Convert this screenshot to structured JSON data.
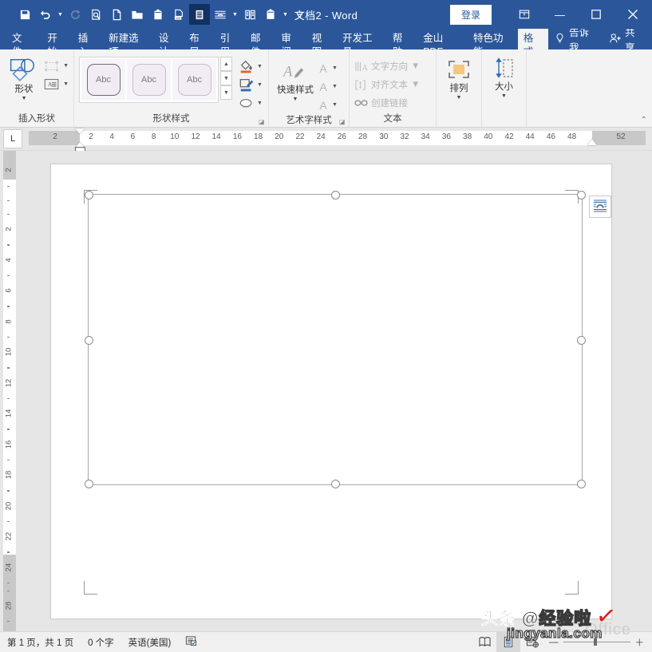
{
  "titlebar": {
    "document_title": "文档2  -  Word",
    "sign_in": "登录",
    "quick_access": [
      {
        "name": "save",
        "glyph": "save"
      },
      {
        "name": "undo",
        "glyph": "undo",
        "has_caret": true
      },
      {
        "name": "redo",
        "glyph": "redo"
      },
      {
        "name": "print-preview",
        "glyph": "preview"
      },
      {
        "name": "new-document",
        "glyph": "newdoc"
      },
      {
        "name": "open",
        "glyph": "open"
      },
      {
        "name": "paste",
        "glyph": "paste"
      },
      {
        "name": "word-count",
        "glyph": "wordcount"
      },
      {
        "name": "draw-table",
        "glyph": "lines",
        "active": true
      },
      {
        "name": "insert-shape",
        "glyph": "arc",
        "has_caret": true
      },
      {
        "name": "columns",
        "glyph": "columns"
      },
      {
        "name": "paste-special",
        "glyph": "paste2",
        "has_caret": true
      },
      {
        "name": "customize-toolbar",
        "glyph": "more"
      }
    ],
    "window_buttons": {
      "ribbon_options": "▣",
      "minimize": "—",
      "maximize": "▢",
      "close": "✕"
    }
  },
  "tabs": {
    "items": [
      {
        "label": "文件",
        "active": false
      },
      {
        "label": "开始",
        "active": false
      },
      {
        "label": "插入",
        "active": false
      },
      {
        "label": "新建选项",
        "active": false
      },
      {
        "label": "设计",
        "active": false
      },
      {
        "label": "布局",
        "active": false
      },
      {
        "label": "引用",
        "active": false
      },
      {
        "label": "邮件",
        "active": false
      },
      {
        "label": "审阅",
        "active": false
      },
      {
        "label": "视图",
        "active": false
      },
      {
        "label": "开发工具",
        "active": false
      },
      {
        "label": "帮助",
        "active": false
      },
      {
        "label": "金山PDF",
        "active": false
      },
      {
        "label": "特色功能",
        "active": false
      },
      {
        "label": "格式",
        "active": true
      }
    ],
    "tell_me": "告诉我",
    "share": "共享"
  },
  "ribbon": {
    "groups": {
      "insert_shapes": {
        "label": "插入形状",
        "shapes_button": "形状",
        "edit_shape_disabled": true,
        "text_box_disabled": true
      },
      "shape_styles": {
        "label": "形状样式",
        "gallery": [
          {
            "label": "Abc",
            "selected": true
          },
          {
            "label": "Abc",
            "selected": false
          },
          {
            "label": "Abc",
            "selected": false
          }
        ],
        "side_buttons": [
          {
            "name": "shape-fill",
            "caret": true
          },
          {
            "name": "shape-outline",
            "caret": true
          },
          {
            "name": "shape-effects",
            "caret": true
          }
        ]
      },
      "wordart_styles": {
        "label": "艺术字样式",
        "quick_styles": "快速样式",
        "letter_buttons": [
          "A",
          "A",
          "A"
        ]
      },
      "text": {
        "label": "文本",
        "items": [
          {
            "label": "文字方向",
            "caret": true
          },
          {
            "label": "对齐文本",
            "caret": true
          },
          {
            "label": "创建链接",
            "caret": false
          }
        ]
      },
      "arrange": {
        "label": "排列"
      },
      "size": {
        "label": "大小"
      }
    },
    "collapse_ribbon_icon": "⌃"
  },
  "ruler": {
    "tab_stop_selector": "L",
    "horizontal_left_margin_label": "2",
    "horizontal_right_margin_label": "52",
    "horizontal_numbers": [
      "2",
      "4",
      "6",
      "8",
      "10",
      "12",
      "14",
      "16",
      "18",
      "20",
      "22",
      "24",
      "26",
      "28",
      "30",
      "32",
      "34",
      "36",
      "38",
      "40",
      "42",
      "44",
      "46",
      "48"
    ],
    "vertical_top_margin_label": "2",
    "vertical_bottom_margin_label": "28",
    "vertical_numbers": [
      "2",
      "4",
      "6",
      "8",
      "10",
      "12",
      "14",
      "16",
      "18",
      "20",
      "22",
      "24"
    ]
  },
  "document": {
    "selected_shape": {
      "name": "rectangle-shape",
      "handles": 8,
      "layout_options_icon": "layout-options-icon"
    },
    "page_text": ""
  },
  "status_bar": {
    "page_info": "第 1 页，共 1 页",
    "word_count": "0 个字",
    "language": "英语(美国)",
    "proofing_icon": "proofing-icon",
    "views": [
      {
        "name": "read-mode",
        "active": false
      },
      {
        "name": "print-layout",
        "active": true
      },
      {
        "name": "web-layout",
        "active": false
      }
    ],
    "zoom_out": "—",
    "zoom_in": "＋"
  },
  "watermark": {
    "line1_prefix": "头条 @",
    "line1_hollow": "经验啦",
    "line2": "jingyanla.com",
    "check": "✓",
    "background_word": "Office",
    "check_color": "#e01b1b"
  }
}
